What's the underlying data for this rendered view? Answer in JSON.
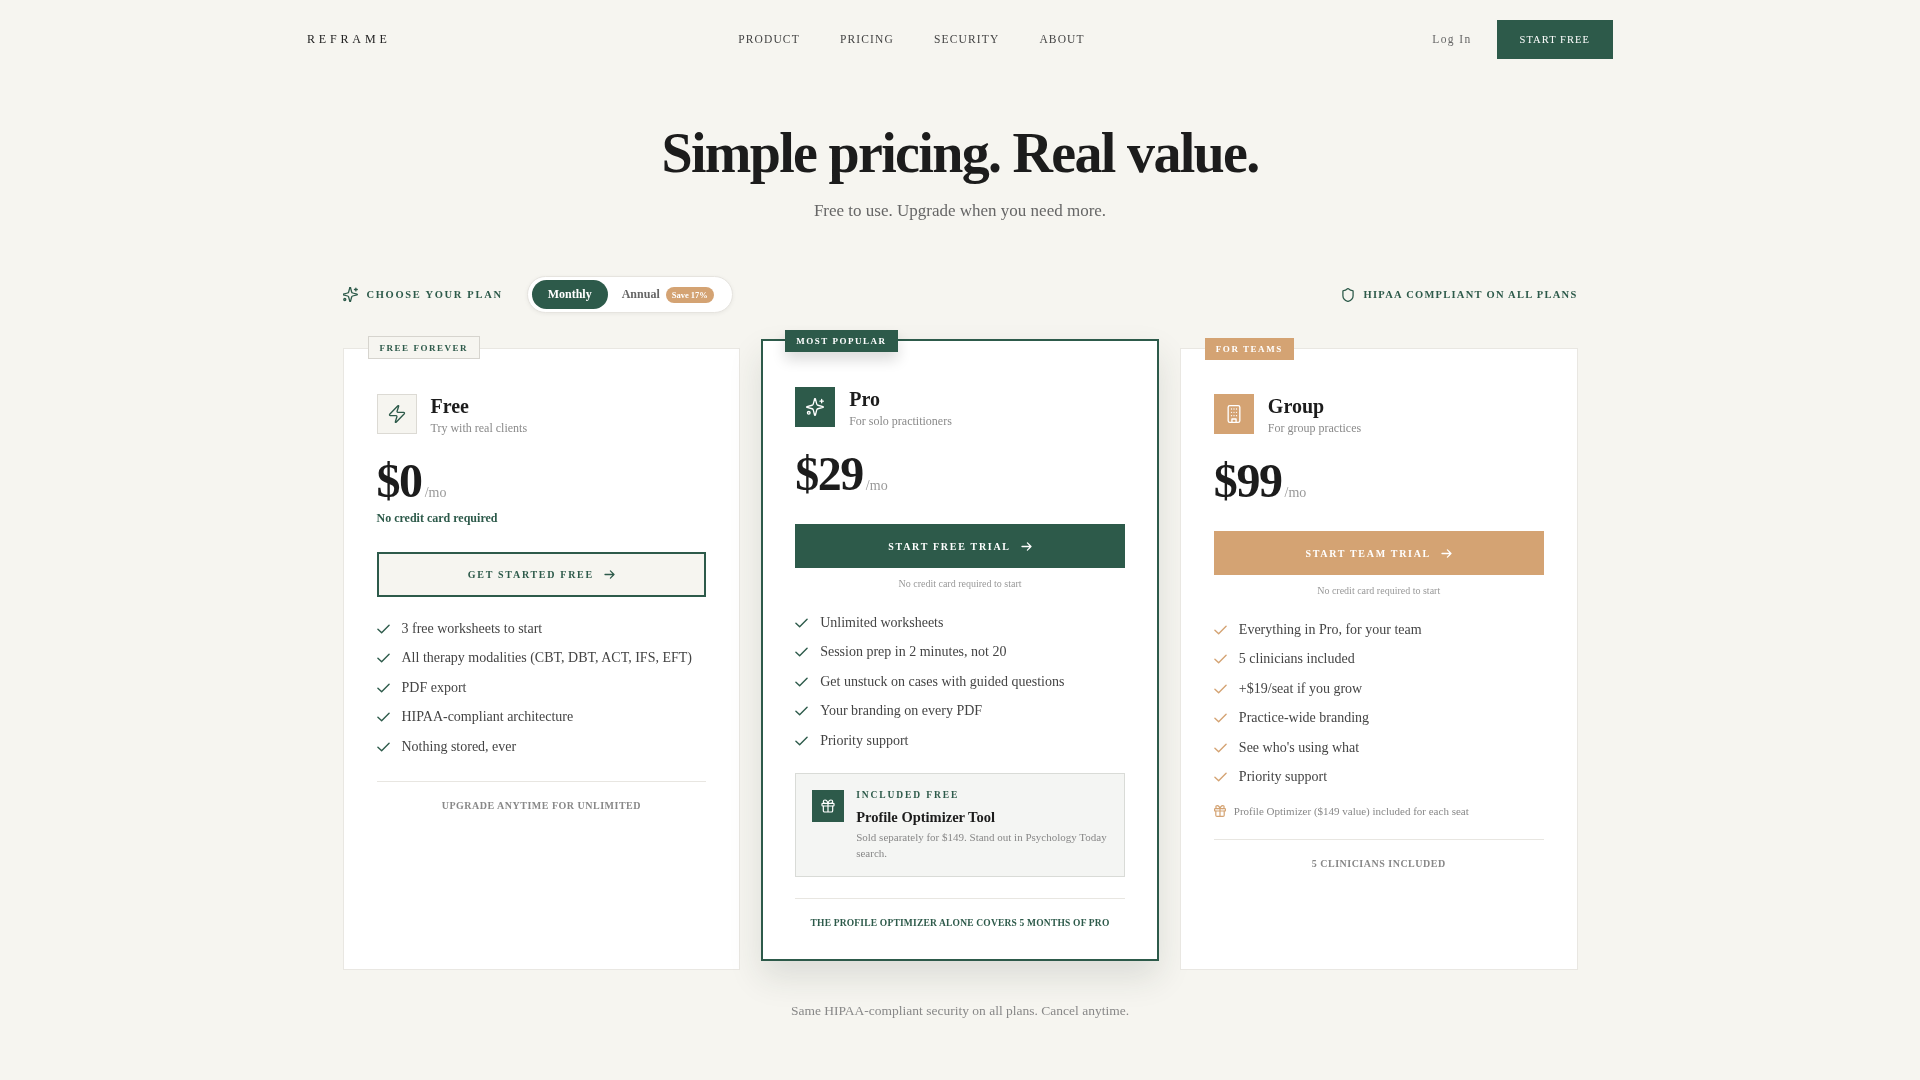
{
  "nav": {
    "logo": "REFRAME",
    "links": [
      {
        "label": "PRODUCT"
      },
      {
        "label": "PRICING"
      },
      {
        "label": "SECURITY"
      },
      {
        "label": "ABOUT"
      }
    ],
    "login": "Log In",
    "cta": "START FREE"
  },
  "hero": {
    "title": "Simple pricing. Real value.",
    "subtitle": "Free to use. Upgrade when you need more."
  },
  "plan_bar": {
    "label": "CHOOSE YOUR PLAN",
    "billing_options": [
      {
        "label": "Monthly",
        "selected": true
      },
      {
        "label": "Annual",
        "selected": false,
        "badge": "Save 17%"
      }
    ],
    "compliance_note": "HIPAA COMPLIANT ON ALL PLANS"
  },
  "plans": [
    {
      "kind": "basic",
      "badge": "FREE FOREVER",
      "name": "Free",
      "tagline": "Try with real clients",
      "price": "$0",
      "period": "/mo",
      "price_note": "No credit card required",
      "button": "GET STARTED FREE",
      "features": [
        "3 free worksheets to start",
        "All therapy modalities (CBT, DBT, ACT, IFS, EFT)",
        "PDF export",
        "HIPAA-compliant architecture",
        "Nothing stored, ever"
      ],
      "footnote": "UPGRADE ANYTIME FOR UNLIMITED"
    },
    {
      "kind": "featured",
      "badge": "MOST POPULAR",
      "name": "Pro",
      "tagline": "For solo practitioners",
      "price": "$29",
      "period": "/mo",
      "button": "START FREE TRIAL",
      "button_note": "No credit card required to start",
      "features": [
        "Unlimited worksheets",
        "Session prep in 2 minutes, not 20",
        "Get unstuck on cases with guided questions",
        "Your branding on every PDF",
        "Priority support"
      ],
      "included": {
        "label": "INCLUDED FREE",
        "title": "Profile Optimizer Tool",
        "description": "Sold separately for $149. Stand out in Psychology Today search."
      },
      "footnote": "THE PROFILE OPTIMIZER ALONE COVERS 5 MONTHS OF PRO"
    },
    {
      "kind": "team",
      "badge": "FOR TEAMS",
      "name": "Group",
      "tagline": "For group practices",
      "price": "$99",
      "period": "/mo",
      "button": "START TEAM TRIAL",
      "button_note": "No credit card required to start",
      "features": [
        "Everything in Pro, for your team",
        "5 clinicians included",
        "+$19/seat if you grow",
        "Practice-wide branding",
        "See who's using what",
        "Priority support"
      ],
      "bonus": "Profile Optimizer ($149 value) included for each seat",
      "footnote": "5 CLINICIANS INCLUDED"
    }
  ],
  "footer_note": "Same HIPAA-compliant security on all plans. Cancel anytime."
}
